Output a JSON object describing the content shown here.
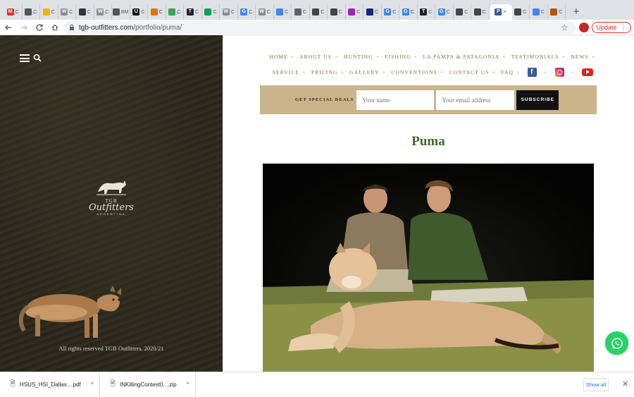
{
  "browser": {
    "tabs": [
      {
        "fav": "M",
        "color": "#d93025",
        "label": "C"
      },
      {
        "fav": "",
        "color": "#555555",
        "label": "C"
      },
      {
        "fav": "",
        "color": "#f4b400",
        "label": "C"
      },
      {
        "fav": "W",
        "color": "#8c8c8c",
        "label": "C"
      },
      {
        "fav": "",
        "color": "#333333",
        "label": "C"
      },
      {
        "fav": "W",
        "color": "#8c8c8c",
        "label": "C"
      },
      {
        "fav": "",
        "color": "#555555",
        "label": "BM"
      },
      {
        "fav": "U",
        "color": "#111111",
        "label": "C"
      },
      {
        "fav": "",
        "color": "#e37400",
        "label": "C"
      },
      {
        "fav": "",
        "color": "#34a853",
        "label": "C"
      },
      {
        "fav": "T",
        "color": "#202124",
        "label": "C"
      },
      {
        "fav": "",
        "color": "#0f9d58",
        "label": "C"
      },
      {
        "fav": "W",
        "color": "#8c8c8c",
        "label": "C"
      },
      {
        "fav": "G",
        "color": "#4285f4",
        "label": "C"
      },
      {
        "fav": "W",
        "color": "#8c8c8c",
        "label": "C"
      },
      {
        "fav": "",
        "color": "#4285f4",
        "label": "C"
      },
      {
        "fav": "",
        "color": "#5f6368",
        "label": "C"
      },
      {
        "fav": "",
        "color": "#444444",
        "label": "C"
      },
      {
        "fav": "",
        "color": "#444444",
        "label": "C"
      },
      {
        "fav": "",
        "color": "#9c27b0",
        "label": "C"
      },
      {
        "fav": "",
        "color": "#1a237e",
        "label": "C"
      },
      {
        "fav": "G",
        "color": "#4285f4",
        "label": "C"
      },
      {
        "fav": "G",
        "color": "#4285f4",
        "label": "C"
      },
      {
        "fav": "T",
        "color": "#202124",
        "label": "C"
      },
      {
        "fav": "G",
        "color": "#4285f4",
        "label": "C"
      },
      {
        "fav": "",
        "color": "#444444",
        "label": "C"
      },
      {
        "fav": "",
        "color": "#444444",
        "label": "C"
      },
      {
        "fav": "P",
        "color": "#3b5998",
        "label": "×"
      },
      {
        "fav": "",
        "color": "#444444",
        "label": "C"
      },
      {
        "fav": "",
        "color": "#4285f4",
        "label": "C"
      },
      {
        "fav": "",
        "color": "#b45309",
        "label": "C"
      }
    ],
    "active_tab_index": 27,
    "new_tab": "+",
    "url_host": "tgb-outfitters.com",
    "url_path": "/portfolio/puma/",
    "update_label": "Update"
  },
  "site": {
    "logo": {
      "top": "TGB",
      "brand": "Outfitters",
      "sub": "ARGENTINA"
    },
    "copyright": "All rights reserved TGB Outfitters. 2020/21",
    "nav_row1": [
      "HOME",
      "ABOUT US",
      "HUNTING",
      "FISHING",
      "LA PAMPA & PATAGONIA",
      "TESTIMONIALS",
      "NEWS"
    ],
    "nav_row2": [
      "SERVICE",
      "PRICING",
      "GALLERY",
      "CONVENTIONS",
      "CONTACT US",
      "FAQ"
    ],
    "deals": {
      "label": "GET SPECIAL DEALS",
      "name_placeholder": "Your name",
      "email_placeholder": "Your email address",
      "button": "SUBSCRIBE"
    },
    "title": "Puma"
  },
  "downloads": {
    "items": [
      {
        "name": "HSUS_HSI_Dallas....pdf"
      },
      {
        "name": "INKillingContest0....zip"
      }
    ],
    "show_all": "Show all"
  },
  "colors": {
    "accent_gold": "#c9b48b",
    "nav_text": "#8a6a3e",
    "title_green": "#3f6a2b",
    "whatsapp": "#25d366"
  }
}
